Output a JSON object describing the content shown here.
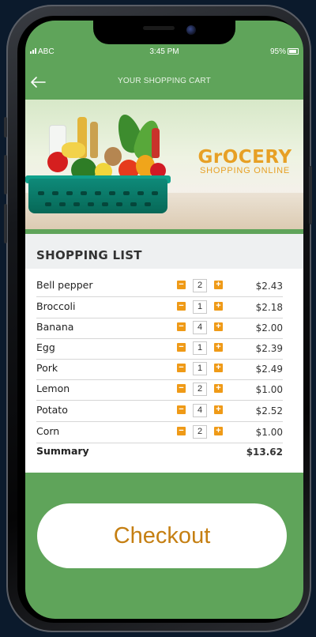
{
  "status_bar": {
    "carrier": "ABC",
    "time": "3:45 PM",
    "battery": "95%"
  },
  "nav": {
    "title": "YOUR SHOPPING CART",
    "back_icon": "arrow-left-icon"
  },
  "banner": {
    "brand_word": "GrOCERY",
    "brand_tagline": "SHOPPING ONLINE",
    "brand_color": "#e7a025"
  },
  "list": {
    "title": "SHOPPING LIST",
    "items": [
      {
        "name": "Bell pepper",
        "qty": "2",
        "price": "$2.43"
      },
      {
        "name": "Broccoli",
        "qty": "1",
        "price": "$2.18"
      },
      {
        "name": "Banana",
        "qty": "4",
        "price": "$2.00"
      },
      {
        "name": "Egg",
        "qty": "1",
        "price": "$2.39"
      },
      {
        "name": "Pork",
        "qty": "1",
        "price": "$2.49"
      },
      {
        "name": "Lemon",
        "qty": "2",
        "price": "$1.00"
      },
      {
        "name": "Potato",
        "qty": "4",
        "price": "$2.52"
      },
      {
        "name": "Corn",
        "qty": "2",
        "price": "$1.00"
      }
    ],
    "summary_label": "Summary",
    "summary_value": "$13.62",
    "minus_glyph": "−",
    "plus_glyph": "+"
  },
  "checkout": {
    "label": "Checkout"
  },
  "colors": {
    "app_green": "#5fa45a",
    "stepper_orange": "#ef9a17",
    "checkout_text": "#c57f12"
  }
}
